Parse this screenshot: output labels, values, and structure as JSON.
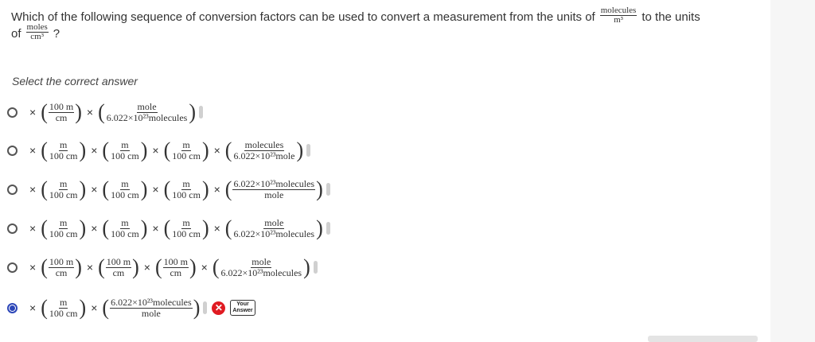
{
  "question": {
    "text_before": "Which of the following sequence of conversion factors can be used to convert a measurement from the units of",
    "from_unit": {
      "num": "molecules",
      "den": "m³"
    },
    "text_middle": "to the units",
    "text_of": "of",
    "to_unit": {
      "num": "moles",
      "den": "cm³"
    },
    "text_end": "?"
  },
  "prompt": "Select the correct answer",
  "times": "×",
  "options": [
    {
      "factors": [
        {
          "n": "100 m",
          "d": "cm"
        },
        {
          "n": "mole",
          "d": "6.022×10²³molecules"
        }
      ],
      "selected": false
    },
    {
      "factors": [
        {
          "n": "m",
          "d": "100 cm"
        },
        {
          "n": "m",
          "d": "100 cm"
        },
        {
          "n": "m",
          "d": "100 cm"
        },
        {
          "n": "molecules",
          "d": "6.022×10²³mole"
        }
      ],
      "selected": false
    },
    {
      "factors": [
        {
          "n": "m",
          "d": "100 cm"
        },
        {
          "n": "m",
          "d": "100 cm"
        },
        {
          "n": "m",
          "d": "100 cm"
        },
        {
          "n": "6.022×10²³molecules",
          "d": "mole"
        }
      ],
      "selected": false
    },
    {
      "factors": [
        {
          "n": "m",
          "d": "100 cm"
        },
        {
          "n": "m",
          "d": "100 cm"
        },
        {
          "n": "m",
          "d": "100 cm"
        },
        {
          "n": "mole",
          "d": "6.022×10²³molecules"
        }
      ],
      "selected": false
    },
    {
      "factors": [
        {
          "n": "100 m",
          "d": "cm"
        },
        {
          "n": "100 m",
          "d": "cm"
        },
        {
          "n": "100 m",
          "d": "cm"
        },
        {
          "n": "mole",
          "d": "6.022×10²³molecules"
        }
      ],
      "selected": false
    },
    {
      "factors": [
        {
          "n": "m",
          "d": "100 cm"
        },
        {
          "n": "6.022×10²³molecules",
          "d": "mole"
        }
      ],
      "selected": true
    }
  ],
  "feedback": {
    "wrong_icon": "x-circle-icon",
    "wrong_glyph": "✕",
    "your_answer_line1": "Your",
    "your_answer_line2": "Answer"
  },
  "colors": {
    "selected": "#2c46b8",
    "wrong": "#e01b22"
  }
}
